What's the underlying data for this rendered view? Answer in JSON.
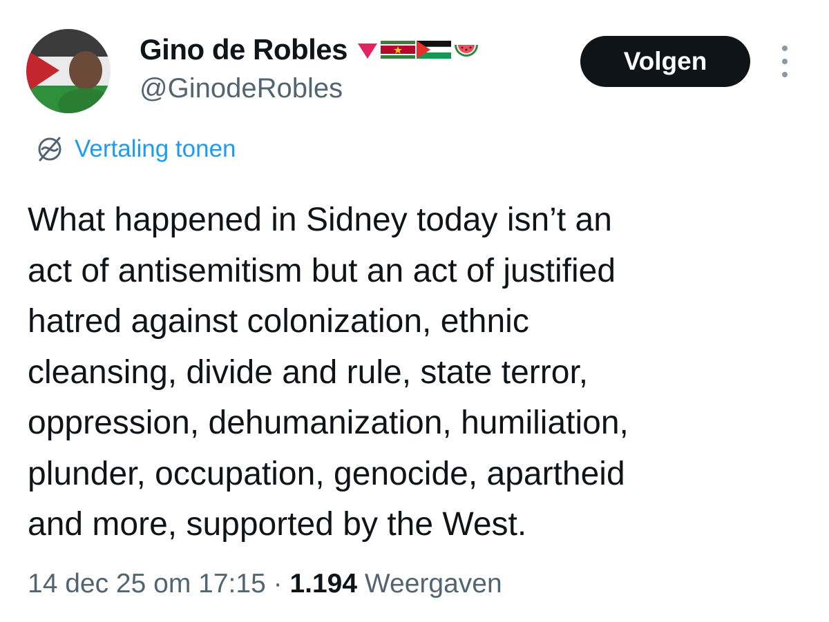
{
  "user": {
    "display_name": "Gino de Robles",
    "handle": "@GinodeRobles",
    "name_emojis": [
      "red-down-triangle-icon",
      "suriname-flag-icon",
      "palestine-flag-icon",
      "watermelon-icon"
    ]
  },
  "actions": {
    "follow_label": "Volgen",
    "more_icon": "more-vertical-icon"
  },
  "translate": {
    "label": "Vertaling tonen",
    "icon": "translate-globe-icon"
  },
  "tweet": {
    "text": "What happened in Sidney today isn’t an\nact of antisemitism but an act of justified\nhatred against colonization, ethnic\ncleansing, divide and rule, state terror,\noppression, dehumanization, humiliation,\nplunder, occupation, genocide, apartheid\nand more, supported by the West."
  },
  "meta": {
    "timestamp": "14 dec 25 om 17:15",
    "separator": "·",
    "views_count": "1.194",
    "views_label": "Weergaven"
  },
  "colors": {
    "accent": "#1d9bf0",
    "button_bg": "#0f1419",
    "secondary_text": "#536471"
  }
}
